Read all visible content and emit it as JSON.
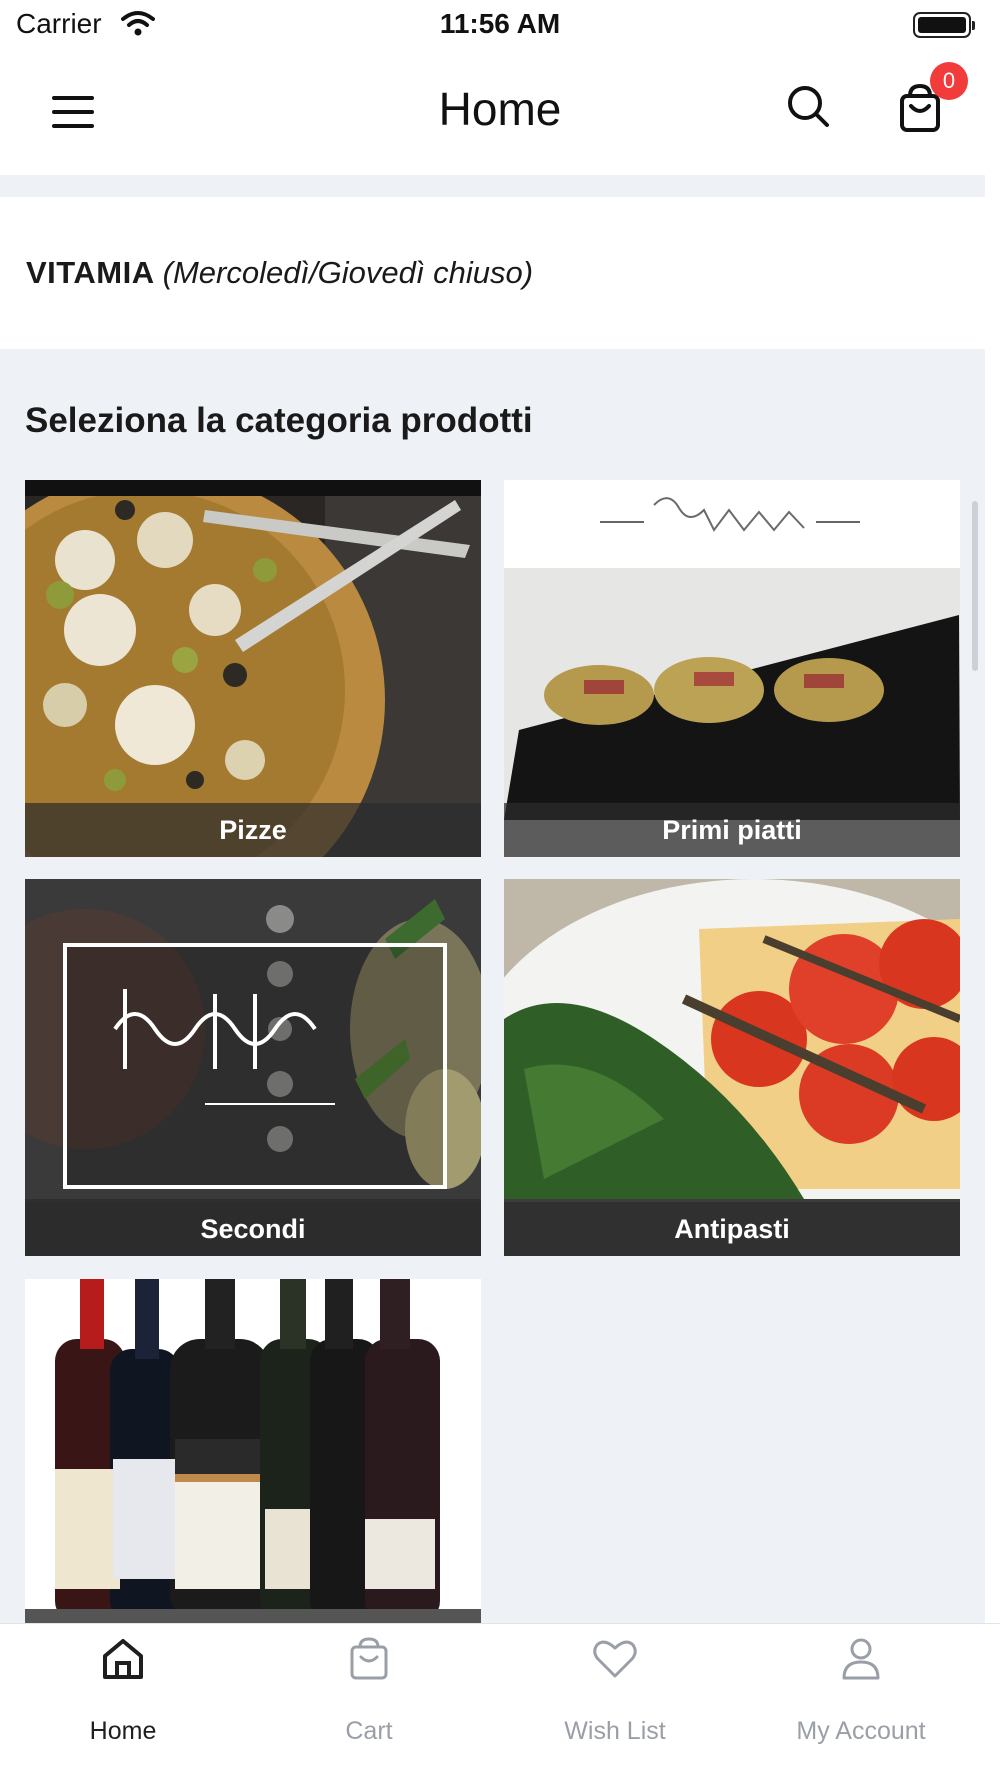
{
  "status_bar": {
    "carrier": "Carrier",
    "time": "11:56 AM"
  },
  "nav": {
    "title": "Home",
    "cart_count": "0",
    "icons": [
      "menu-icon",
      "search-icon",
      "shopping-bag-icon"
    ]
  },
  "store": {
    "name": "VITAMIA",
    "note": "(Mercoledì/Giovedì chiuso)"
  },
  "categories": {
    "title": "Seleziona la categoria prodotti",
    "items": [
      {
        "label": "Pizze"
      },
      {
        "label": "Primi piatti"
      },
      {
        "label": "Secondi"
      },
      {
        "label": "Antipasti"
      },
      {
        "label": ""
      }
    ]
  },
  "tabs": [
    {
      "label": "Home",
      "icon": "home-icon",
      "active": true
    },
    {
      "label": "Cart",
      "icon": "shopping-bag-icon",
      "active": false
    },
    {
      "label": "Wish List",
      "icon": "heart-icon",
      "active": false
    },
    {
      "label": "My Account",
      "icon": "user-icon",
      "active": false
    }
  ],
  "colors": {
    "badge": "#f23b3b",
    "background": "#eef1f5",
    "active_tab": "#1f1f1f",
    "inactive_tab": "#9a9fa7"
  }
}
